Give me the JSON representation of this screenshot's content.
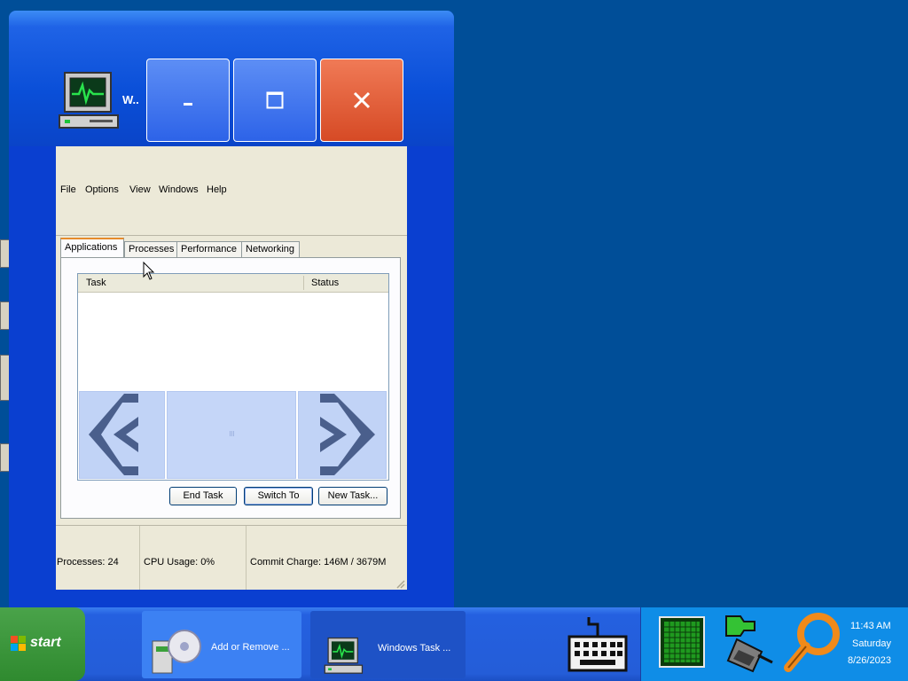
{
  "window": {
    "title": "W..",
    "icon": "task-manager-monitor-icon",
    "menu": [
      "File",
      "Options",
      "View",
      "Windows",
      "Help"
    ],
    "tabs": [
      "Applications",
      "Processes",
      "Performance",
      "Networking"
    ],
    "active_tab": "Applications",
    "columns": {
      "task": "Task",
      "status": "Status"
    },
    "buttons": {
      "end_task": "End Task",
      "switch_to": "Switch To",
      "new_task": "New Task..."
    },
    "status": {
      "processes": "Processes: 24",
      "cpu": "CPU Usage: 0%",
      "commit": "Commit Charge: 146M / 3679M"
    }
  },
  "taskbar": {
    "start_label": "start",
    "tasks": [
      {
        "label": "Add or Remove ...",
        "icon": "cd-install-icon"
      },
      {
        "label": "Windows Task ...",
        "icon": "task-manager-monitor-icon"
      }
    ],
    "quicklaunch": [
      "keyboard-icon"
    ],
    "tray_icons": [
      "cpu-graph-icon",
      "network-plug-icon",
      "search-magnifier-icon"
    ],
    "clock": {
      "time": "11:43 AM",
      "day": "Saturday",
      "date": "8/26/2023"
    }
  },
  "colors": {
    "desktop": "#004e98",
    "title_blue": "#0a4fd8",
    "close_red": "#d64a25",
    "client_beige": "#ece9d8",
    "tray_blue": "#0f8de7"
  }
}
